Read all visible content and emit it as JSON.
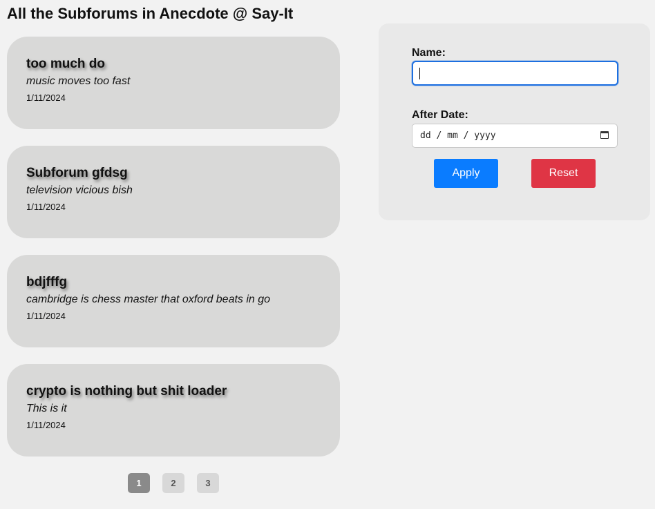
{
  "page": {
    "title": "All the Subforums in Anecdote @ Say-It"
  },
  "subforums": [
    {
      "name": "too much do",
      "description": "music moves too fast",
      "date": "1/11/2024"
    },
    {
      "name": "Subforum gfdsg",
      "description": "television vicious bish",
      "date": "1/11/2024"
    },
    {
      "name": "bdjfffg",
      "description": "cambridge is chess master that oxford beats in go",
      "date": "1/11/2024"
    },
    {
      "name": "crypto is nothing but shit loader",
      "description": "This is it",
      "date": "1/11/2024"
    }
  ],
  "pagination": {
    "pages": [
      "1",
      "2",
      "3"
    ],
    "current": "1"
  },
  "filter": {
    "name_label": "Name:",
    "name_value": "",
    "date_label": "After Date:",
    "date_placeholder": "dd / mm / yyyy",
    "calendar_icon": "calendar-icon",
    "apply_label": "Apply",
    "reset_label": "Reset",
    "apply_color": "#0a7cff",
    "reset_color": "#df3545"
  }
}
